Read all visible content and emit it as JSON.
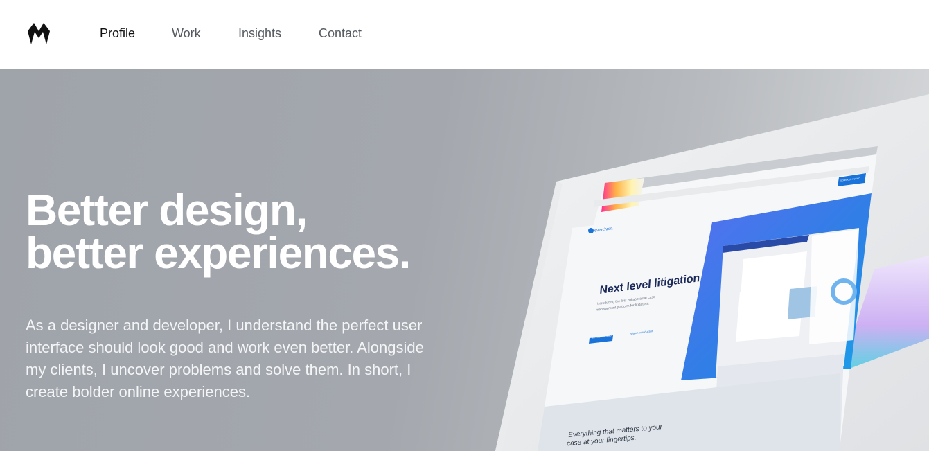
{
  "nav": {
    "links": [
      {
        "label": "Profile",
        "active": true
      },
      {
        "label": "Work",
        "active": false
      },
      {
        "label": "Insights",
        "active": false
      },
      {
        "label": "Contact",
        "active": false
      }
    ]
  },
  "hero": {
    "title_line1": "Better design,",
    "title_line2": "better experiences.",
    "copy": "As a designer and developer, I understand the perfect user interface should look good and work even better. Alongside my clients, I uncover problems and solve them. In short, I create bolder online experiences."
  },
  "mockup": {
    "brand": "everchron",
    "headline": "Next level litigation",
    "subtext_line1": "Introducing the first collaborative case",
    "subtext_line2": "management platform for litigators.",
    "cta": "SCHEDULE A DEMO",
    "secondary_cta": "Watch Introduction",
    "top_cta": "SCHEDULE A DEMO",
    "footer_line1": "Everything that matters to your",
    "footer_line2": "case at your fingertips."
  },
  "colors": {
    "accent_blue": "#1a73d9",
    "headline_navy": "#1b2a5a",
    "hero_gray": "#a2a6ac"
  }
}
